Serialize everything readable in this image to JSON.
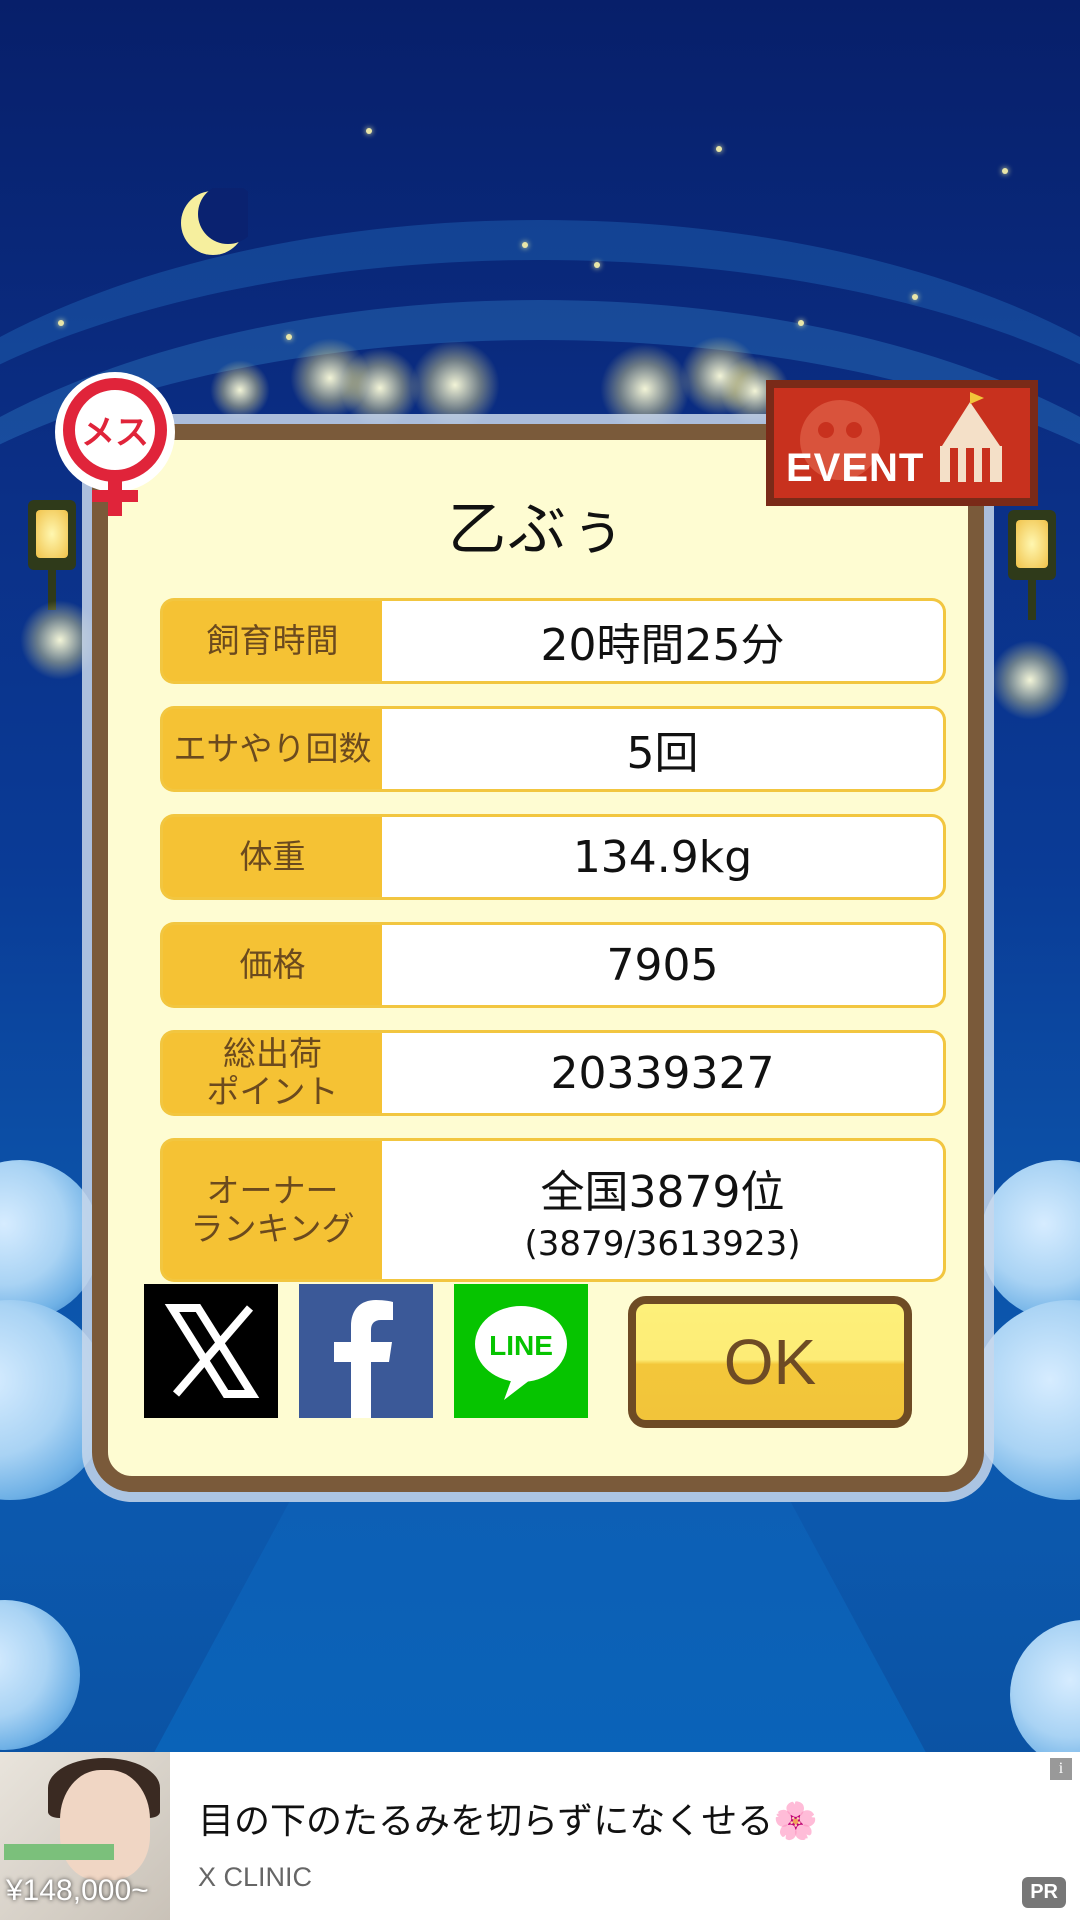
{
  "dialog": {
    "title": "乙ぶぅ",
    "rows": [
      {
        "label": "飼育時間",
        "value": "20時間25分"
      },
      {
        "label": "エサやり回数",
        "value": "5回"
      },
      {
        "label": "体重",
        "value": "134.9kg"
      },
      {
        "label": "価格",
        "value": "7905"
      },
      {
        "label": "総出荷\nポイント",
        "value": "20339327"
      },
      {
        "label": "オーナー\nランキング",
        "value": "全国3879位",
        "sub": "(3879/3613923)"
      }
    ],
    "ok_label": "OK",
    "line_label": "LINE",
    "gender_label": "メス",
    "event_label": "EVENT"
  },
  "ad": {
    "title": "目の下のたるみを切らずになくせる🌸",
    "advertiser": "X CLINIC",
    "price": "¥148,000~",
    "pr_badge": "PR",
    "info_icon": "i"
  },
  "colors": {
    "label_bg": "#f5c234",
    "frame": "#7a5a3a",
    "panel": "#fefcd2"
  }
}
